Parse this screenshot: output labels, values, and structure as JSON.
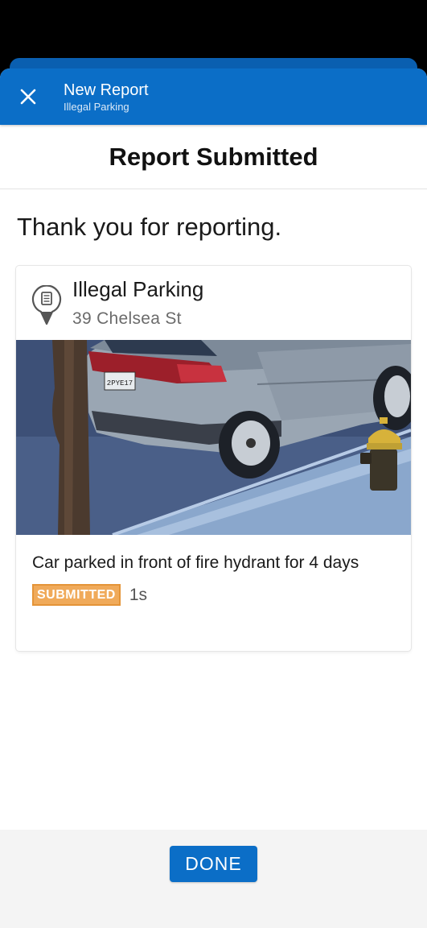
{
  "nav": {
    "title": "New Report",
    "subtitle": "Illegal Parking",
    "close_icon": "close-icon"
  },
  "header": {
    "title": "Report Submitted"
  },
  "message": "Thank you for reporting.",
  "report": {
    "category": "Illegal Parking",
    "address": "39 Chelsea St",
    "icon": "document-pin-icon",
    "photo_plate_text": "2PYE17",
    "description": "Car parked in front of fire hydrant for 4 days",
    "status": "SUBMITTED",
    "elapsed": "1s"
  },
  "footer": {
    "done_label": "DONE"
  },
  "colors": {
    "primary": "#0b6ec7",
    "status_badge": "#f0aa5a",
    "background": "#ffffff"
  }
}
